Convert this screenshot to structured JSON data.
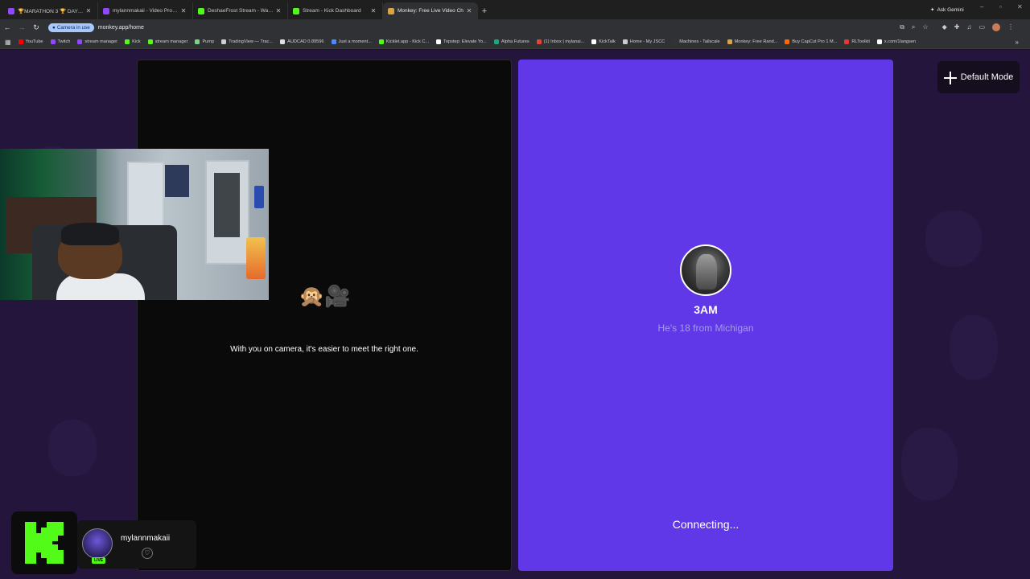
{
  "browser": {
    "tabs": [
      {
        "title": "🏆MARATHON 3 🏆 DAY 1 🏆 L",
        "favicon_color": "#9146ff",
        "active": false
      },
      {
        "title": "mylannmakaii - Video Producti",
        "favicon_color": "#9146ff",
        "active": false
      },
      {
        "title": "DeshaeFrost Stream - Watch Li",
        "favicon_color": "#53fc18",
        "active": false
      },
      {
        "title": "Stream - Kick Dashboard",
        "favicon_color": "#53fc18",
        "active": false
      },
      {
        "title": "Monkey: Free Live Video Ch",
        "favicon_color": "#d9a441",
        "active": true
      }
    ],
    "new_tab_label": "+",
    "ask_gemini_label": "Ask Gemini",
    "camera_pill_label": "Camera in use",
    "url": "monkey.app/home",
    "bookmarks": [
      {
        "label": "YouTube",
        "color": "#ff0000"
      },
      {
        "label": "Twitch",
        "color": "#9146ff"
      },
      {
        "label": "stream manager",
        "color": "#9146ff"
      },
      {
        "label": "Kick",
        "color": "#53fc18"
      },
      {
        "label": "stream manager",
        "color": "#53fc18"
      },
      {
        "label": "Pump",
        "color": "#7bd389"
      },
      {
        "label": "TradingView — Trac...",
        "color": "#cfcfcf"
      },
      {
        "label": "AUDCAD 0.89596",
        "color": "#e0e0e0"
      },
      {
        "label": "Just a moment...",
        "color": "#4a8cff"
      },
      {
        "label": "Kicklet.app - Kick C...",
        "color": "#53fc18"
      },
      {
        "label": "Topstep: Elevate Yo...",
        "color": "#ffffff"
      },
      {
        "label": "Alpha Futures",
        "color": "#1fa67a"
      },
      {
        "label": "(1) Inbox | mylanai...",
        "color": "#ea4335"
      },
      {
        "label": "KickTalk",
        "color": "#ffffff"
      },
      {
        "label": "Home - My JSCC",
        "color": "#cccccc"
      },
      {
        "label": "Machines - Tailscale",
        "color": "#333333"
      },
      {
        "label": "Monkey: Free Rand...",
        "color": "#d9a441"
      },
      {
        "label": "Buy CapCut Pro 1 M...",
        "color": "#ff6a00"
      },
      {
        "label": "RLToolkit",
        "color": "#e53935"
      },
      {
        "label": "x.com/1langsen",
        "color": "#ffffff"
      }
    ]
  },
  "page": {
    "left_panel": {
      "emoji": "🙊🎥",
      "message": "With you on camera, it's easier to meet the right one."
    },
    "right_panel": {
      "name": "3AM",
      "subtitle": "He's 18 from Michigan",
      "status": "Connecting..."
    },
    "default_mode_label": "Default Mode"
  },
  "overlay": {
    "username": "mylannmakaii",
    "live_badge": "LIVE",
    "kick_color": "#53fc18"
  }
}
